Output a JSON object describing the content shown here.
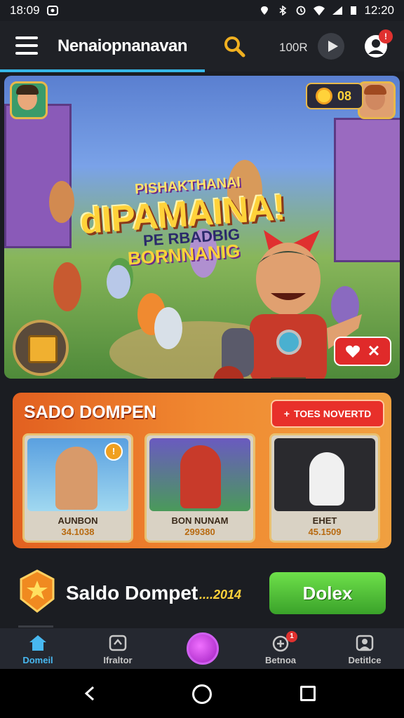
{
  "status_bar": {
    "time": "18:09",
    "right_time": "12:20"
  },
  "app_bar": {
    "title": "Nenaiopnanavan",
    "coins": "100R",
    "profile_badge": "!"
  },
  "hero": {
    "line1": "PISHAKTHANAI",
    "line2": "dIPAMAINA!",
    "line3": "PE RBADBIG",
    "line4": "BORNNANIG",
    "counter_value": "08",
    "favorite_x": "✕"
  },
  "panel": {
    "title": "SADO DOMPEN",
    "button_label": "TOES NOVERTD",
    "cards": [
      {
        "name": "AUNBON",
        "value": "34.1038",
        "tag": "!"
      },
      {
        "name": "BON NUNAM",
        "value": "299380",
        "tag": ""
      },
      {
        "name": "EHET",
        "value": "45.1509",
        "tag": ""
      }
    ]
  },
  "wallet": {
    "label": "Saldo Dompet",
    "amount": "....2014",
    "action_label": "Dolex"
  },
  "bottom_nav": {
    "items": [
      {
        "label": "Domeil"
      },
      {
        "label": "Ifraltor"
      },
      {
        "label": ""
      },
      {
        "label": "Betnoa",
        "badge": "1"
      },
      {
        "label": "Detitlce"
      }
    ]
  },
  "colors": {
    "accent_blue": "#48b8f0",
    "panel_orange": "#f08830",
    "ok_green": "#4cc230",
    "alert_red": "#e0312f"
  }
}
